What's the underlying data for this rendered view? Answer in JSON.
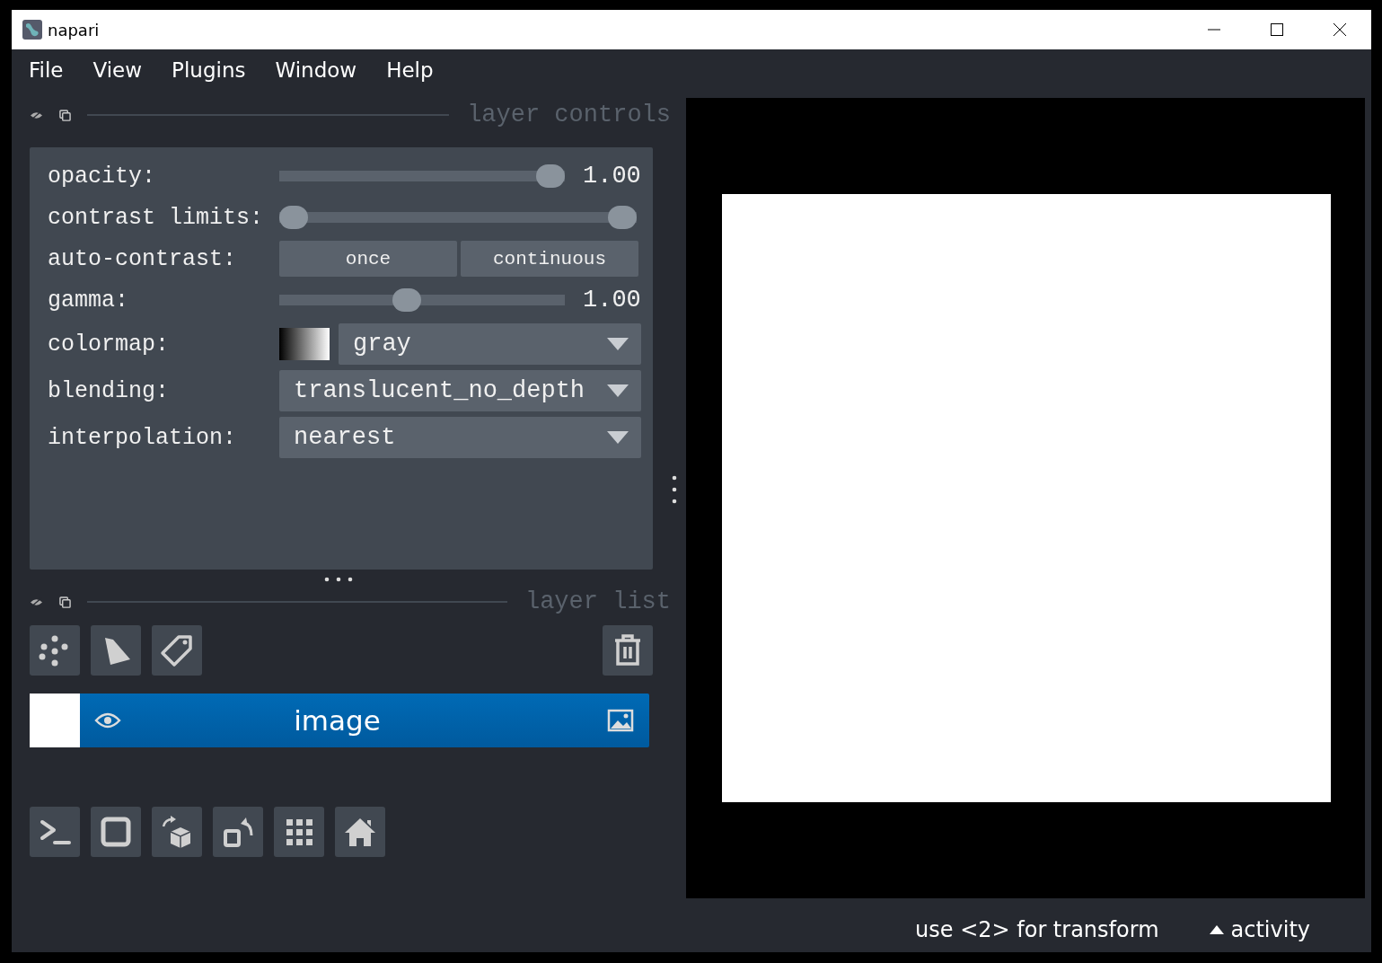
{
  "window": {
    "title": "napari"
  },
  "menu": [
    "File",
    "View",
    "Plugins",
    "Window",
    "Help"
  ],
  "layer_controls": {
    "title": "layer controls",
    "controls": [
      {
        "kind": "slider",
        "label": "opacity:",
        "level": 1,
        "reading": "1.00"
      },
      {
        "kind": "range",
        "label": "contrast limits:",
        "low": {
          "level": 0
        },
        "high": {
          "level": 1
        }
      },
      {
        "kind": "buttons",
        "label": "auto-contrast:",
        "buttons": [
          "once",
          "continuous"
        ]
      },
      {
        "kind": "slider",
        "label": "gamma:",
        "level": 0.44,
        "reading": "1.00"
      },
      {
        "kind": "colormap",
        "label": "colormap:",
        "value": "gray"
      },
      {
        "kind": "dropdown",
        "label": "blending:",
        "value": "translucent_no_depth"
      },
      {
        "kind": "dropdown",
        "label": "interpolation:",
        "value": "nearest"
      }
    ]
  },
  "layer_list": {
    "title": "layer list",
    "layers": [
      {
        "name": "image",
        "kind": "image",
        "visible": true,
        "selected": true
      }
    ]
  },
  "status_bar": {
    "message": "use <2> for transform",
    "activity": "activity"
  }
}
